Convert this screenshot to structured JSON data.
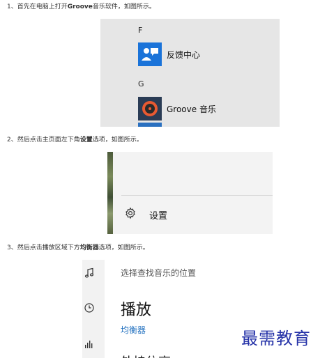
{
  "steps": [
    {
      "prefix": "1、首先在电脑上打开",
      "bold": "Groove",
      "suffix": "音乐软件，如图所示。"
    },
    {
      "prefix": "2、然后点击主页面左下角",
      "bold": "设置",
      "suffix": "选项，如图所示。"
    },
    {
      "prefix": "3、然后点击播放区域下方",
      "bold": "均衡器",
      "suffix": "选项，如图所示。"
    }
  ],
  "start_menu": {
    "sections": [
      {
        "letter": "F",
        "app": "反馈中心",
        "icon": "feedback-hub-icon"
      },
      {
        "letter": "G",
        "app": "Groove 音乐",
        "icon": "groove-music-icon"
      }
    ]
  },
  "settings_panel": {
    "label": "设置",
    "icon": "gear-icon"
  },
  "playback_panel": {
    "search_text": "选择查找音乐的位置",
    "heading": "播放",
    "equalizer_link": "均衡器",
    "cut_heading": "外挂位亮"
  },
  "watermark": "最需教育",
  "colors": {
    "tile_blue": "#1a73d9",
    "link_blue": "#1f6fbf",
    "watermark": "#2633a8"
  }
}
